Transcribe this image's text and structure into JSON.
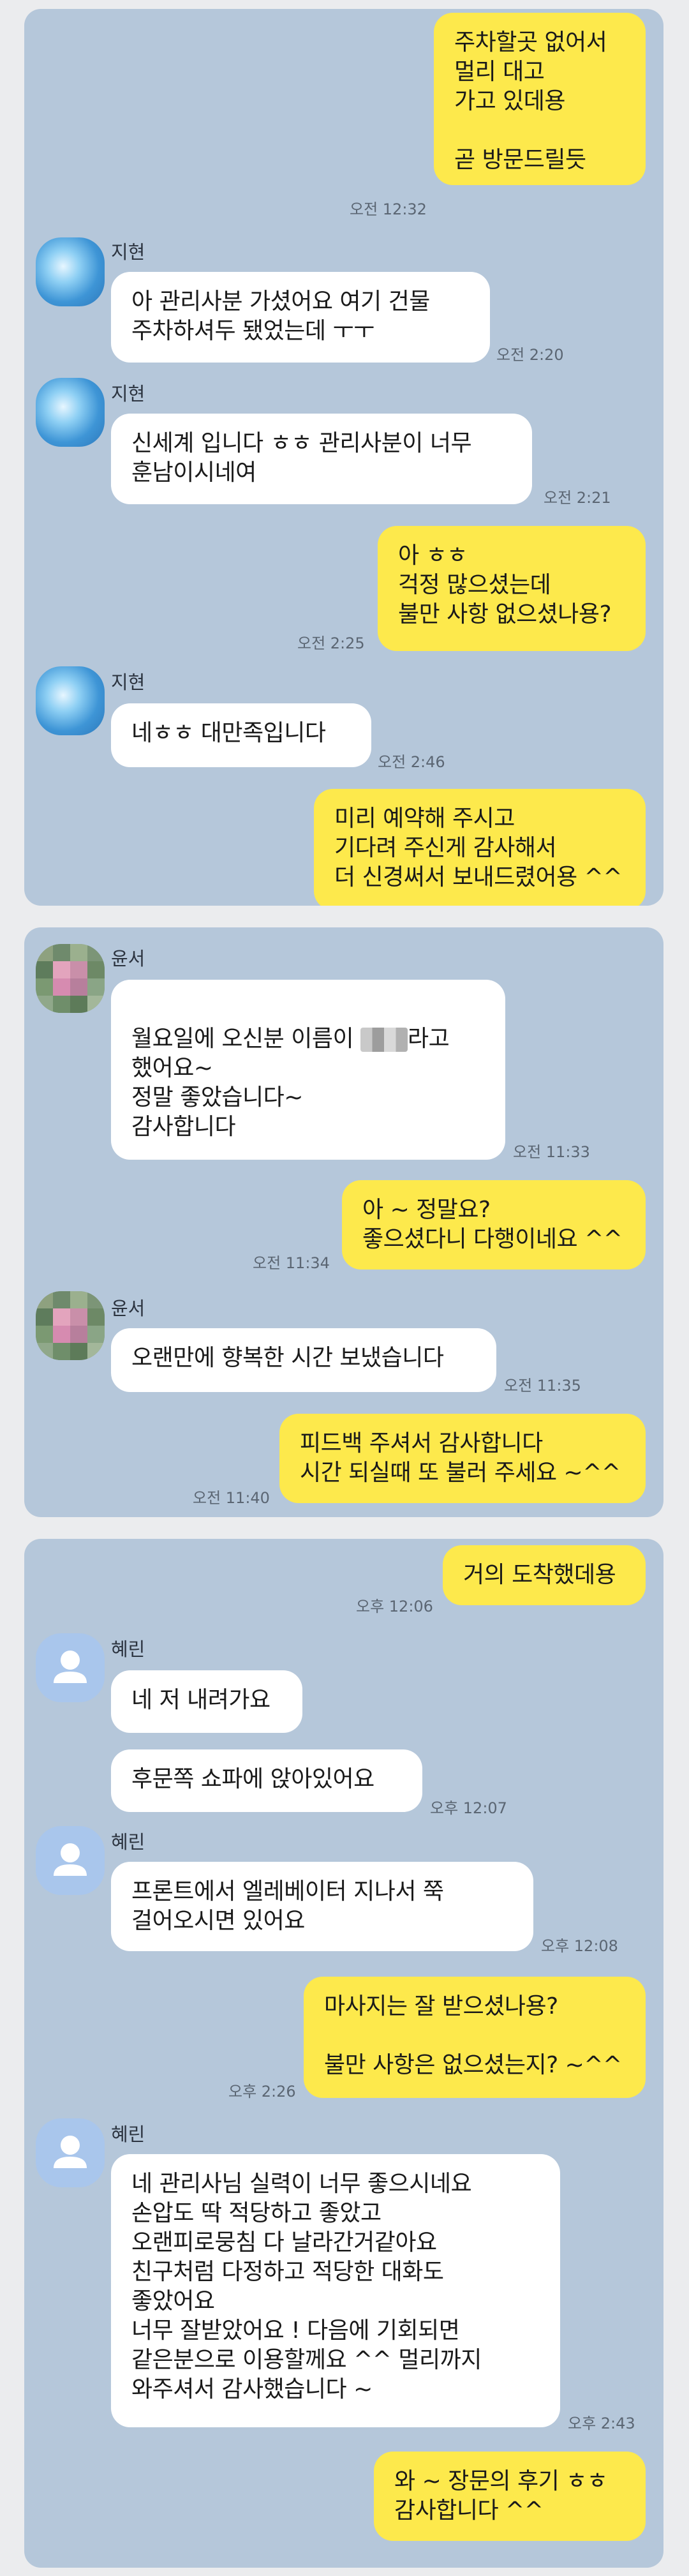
{
  "sections": [
    {
      "messages": [
        {
          "text": "주차할곳 없어서\n멀리 대고\n가고 있데용\n\n곧 방문드릴듯",
          "time": "오전 12:32"
        },
        {
          "sender": "지현",
          "text": "아 관리사분 가셨어요 여기 건물\n주차하셔두 됐었는데 ㅜㅜ",
          "time": "오전 2:20"
        },
        {
          "sender": "지현",
          "text": "신세계 입니다 ㅎㅎ 관리사분이 너무\n훈남이시네여",
          "time": "오전 2:21"
        },
        {
          "text": "아 ㅎㅎ\n걱정 많으셨는데\n불만 사항 없으셨나용?",
          "time": "오전 2:25"
        },
        {
          "sender": "지현",
          "text": "네ㅎㅎ 대만족입니다",
          "time": "오전 2:46"
        },
        {
          "text": "미리 예약해 주시고\n기다려 주신게 감사해서\n더 신경써서 보내드렸어용 ^^"
        }
      ]
    },
    {
      "messages": [
        {
          "sender": "윤서",
          "text_before": "월요일에 오신분 이름이 ",
          "text_after": "라고\n했어요~\n정말 좋았습니다~\n감사합니다",
          "time": "오전 11:33"
        },
        {
          "text": "아 ~ 정말요?\n좋으셨다니 다행이네요 ^^",
          "time": "오전 11:34"
        },
        {
          "sender": "윤서",
          "text": "오랜만에 향복한 시간 보냈습니다",
          "time": "오전 11:35"
        },
        {
          "text": "피드백 주셔서 감사합니다\n시간 되실때 또 불러 주세요 ~^^",
          "time": "오전 11:40"
        }
      ]
    },
    {
      "messages": [
        {
          "text": "거의 도착했데용",
          "time": "오후 12:06"
        },
        {
          "sender": "혜린",
          "text": "네 저 내려가요"
        },
        {
          "text": "후문쪽 쇼파에 앉아있어요",
          "time": "오후 12:07"
        },
        {
          "sender": "혜린",
          "text": "프론트에서 엘레베이터 지나서 쭉\n걸어오시면 있어요",
          "time": "오후 12:08"
        },
        {
          "text": "마사지는 잘 받으셨나용?\n\n불만 사항은 없으셨는지? ~^^",
          "time": "오후 2:26"
        },
        {
          "sender": "혜린",
          "text": "네 관리사님 실력이 너무 좋으시네요\n손압도 딱 적당하고 좋았고\n오랜피로뭉침 다 날라간거같아요\n친구처럼 다정하고 적당한 대화도\n좋았어요\n너무 잘받았어요 ! 다음에 기회되면\n같은분으로 이용할께요 ^^ 멀리까지\n와주셔서 감사했습니다 ~",
          "time": "오후 2:43"
        },
        {
          "text": "와 ~ 장문의 후기 ㅎㅎ\n감사합니다 ^^"
        }
      ]
    }
  ],
  "icons": {
    "avatar1": "sky-photo-avatar",
    "avatar2": "pixelated-photo-avatar",
    "avatar3": "default-person-avatar"
  },
  "colors": {
    "panel": "#b5c7da",
    "my_bubble": "#fde94c",
    "other_bubble": "#ffffff"
  }
}
